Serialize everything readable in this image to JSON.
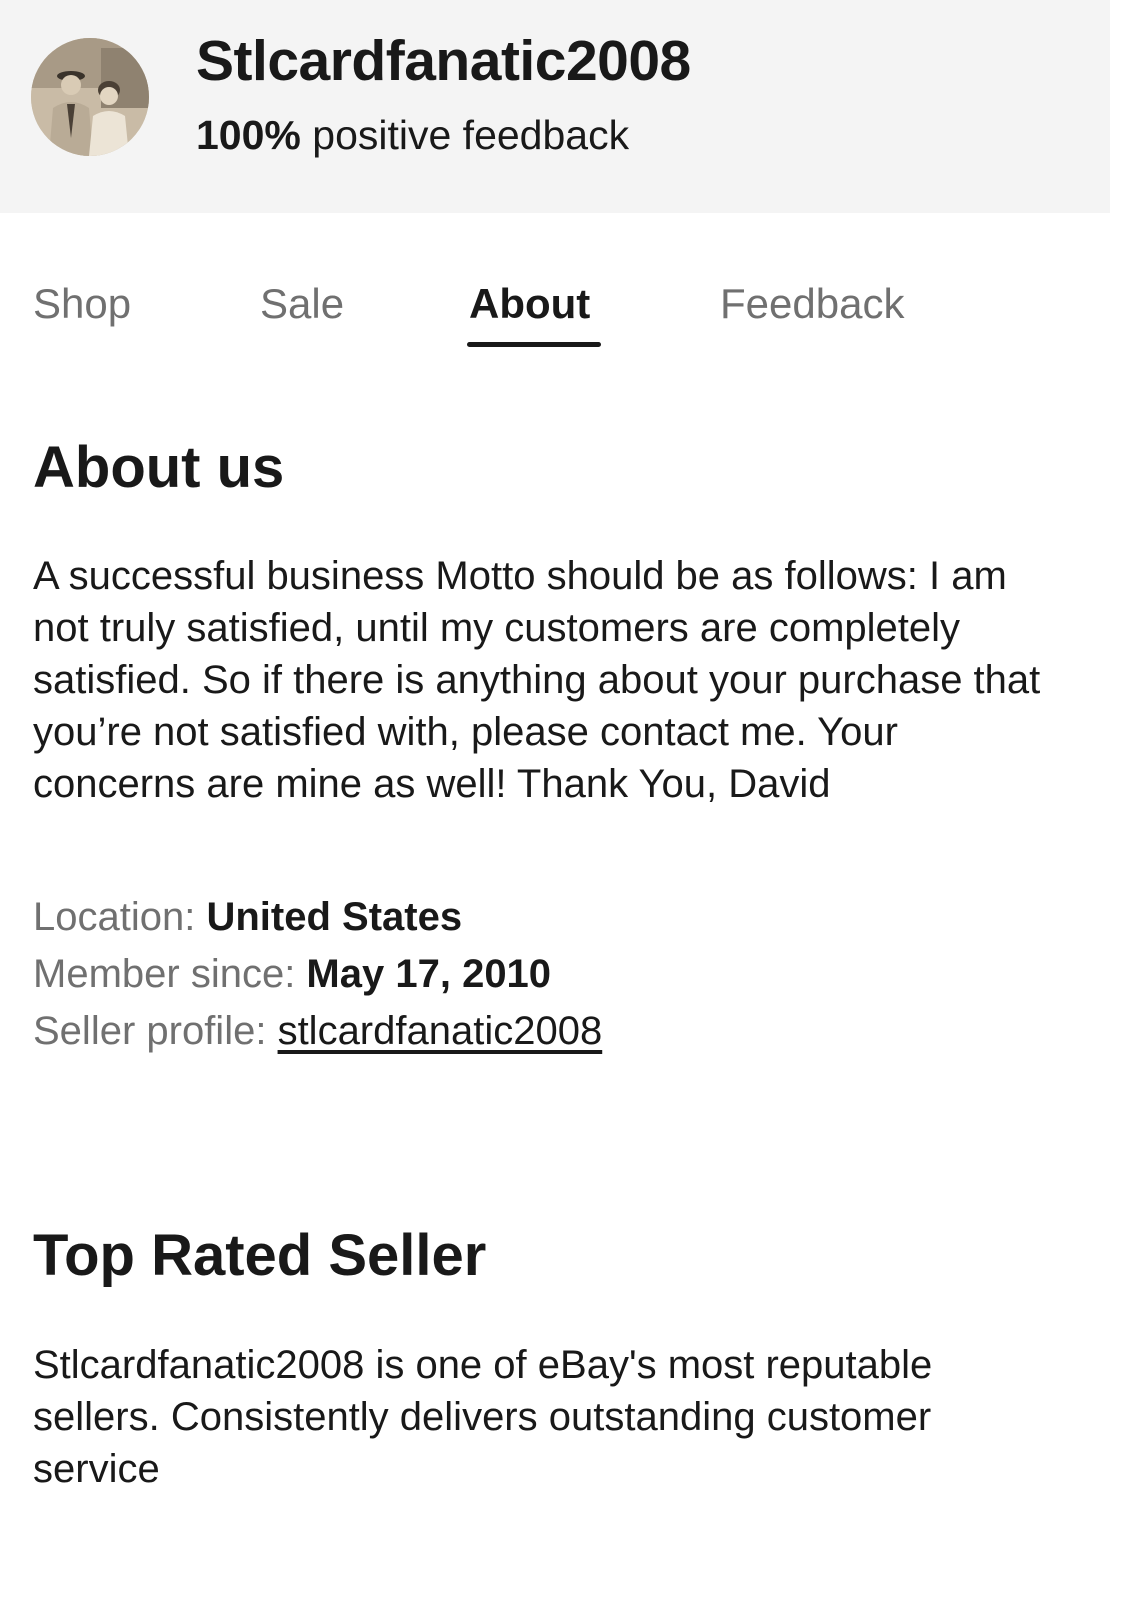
{
  "header": {
    "seller_name": "Stlcardfanatic2008",
    "feedback_percent": "100%",
    "feedback_suffix": " positive feedback"
  },
  "tabs": [
    {
      "label": "Shop",
      "active": false
    },
    {
      "label": "Sale",
      "active": false
    },
    {
      "label": "About",
      "active": true
    },
    {
      "label": "Feedback",
      "active": false
    }
  ],
  "about": {
    "title": "About us",
    "text": "A successful business Motto should be as follows: I am not truly satisfied, until my customers are completely satisfied. So if there is anything about your purchase that you’re not satisfied with, please contact me. Your concerns are mine as well! Thank You, David",
    "location_label": "Location: ",
    "location_value": "United States",
    "member_since_label": "Member since: ",
    "member_since_value": "May 17, 2010",
    "seller_profile_label": "Seller profile: ",
    "seller_profile_link": "stlcardfanatic2008"
  },
  "top_rated": {
    "title": "Top Rated Seller",
    "text": "Stlcardfanatic2008 is one of eBay's most reputable sellers. Consistently delivers outstanding customer service"
  }
}
